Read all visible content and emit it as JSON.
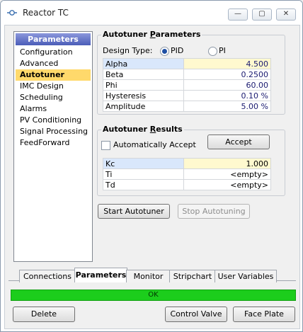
{
  "window": {
    "title": "Reactor TC",
    "minimize": "—",
    "maximize": "▢",
    "close": "✕"
  },
  "nav": {
    "header": "Parameters",
    "items": [
      "Configuration",
      "Advanced",
      "Autotuner",
      "IMC Design",
      "Scheduling",
      "Alarms",
      "PV Conditioning",
      "Signal Processing",
      "FeedForward"
    ],
    "selected": "Autotuner"
  },
  "autotuner_params": {
    "title_prefix": "Autotuner ",
    "title_underlined": "P",
    "title_suffix": "arameters",
    "design_type_label": "Design Type:",
    "options": [
      {
        "label": "PID",
        "selected": true
      },
      {
        "label": "PI",
        "selected": false
      }
    ],
    "rows": [
      {
        "name": "Alpha",
        "value": "4.500"
      },
      {
        "name": "Beta",
        "value": "0.2500"
      },
      {
        "name": "Phi",
        "value": "60.00"
      },
      {
        "name": "Hysteresis",
        "value": "0.10 %"
      },
      {
        "name": "Amplitude",
        "value": "5.00 %"
      }
    ]
  },
  "autotuner_results": {
    "title_prefix": "Autotuner ",
    "title_underlined": "R",
    "title_suffix": "esults",
    "auto_accept_label": "Automatically Accept",
    "auto_accept_checked": false,
    "accept_label": "Accept",
    "rows": [
      {
        "name": "Kc",
        "value": "1.000"
      },
      {
        "name": "Ti",
        "value": "<empty>"
      },
      {
        "name": "Td",
        "value": "<empty>"
      }
    ]
  },
  "actions": {
    "start_label": "Start Autotuner",
    "stop_label": "Stop Autotuning"
  },
  "tabs": [
    "Connections",
    "Parameters",
    "Monitor",
    "Stripchart",
    "User Variables"
  ],
  "selected_tab": "Parameters",
  "status": {
    "text": "OK",
    "color": "#1ccd1c"
  },
  "footer": {
    "delete_label": "Delete",
    "control_valve_label": "Control Valve",
    "face_plate_label": "Face Plate"
  }
}
